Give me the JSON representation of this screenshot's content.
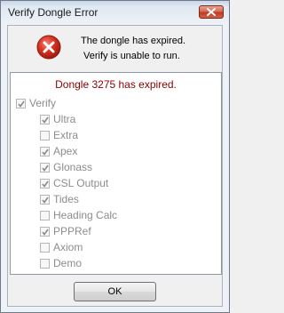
{
  "window": {
    "title": "Verify Dongle Error",
    "close_label": "Close"
  },
  "message": {
    "line1": "The dongle has expired.",
    "line2": "Verify is unable to run.",
    "icon": "error-icon"
  },
  "panel": {
    "status": "Dongle 3275 has expired.",
    "parent": {
      "label": "Verify",
      "checked": true
    },
    "items": [
      {
        "label": "Ultra",
        "checked": true
      },
      {
        "label": "Extra",
        "checked": false
      },
      {
        "label": "Apex",
        "checked": true
      },
      {
        "label": "Glonass",
        "checked": true
      },
      {
        "label": "CSL Output",
        "checked": true
      },
      {
        "label": "Tides",
        "checked": true
      },
      {
        "label": "Heading Calc",
        "checked": false
      },
      {
        "label": "PPPRef",
        "checked": true
      },
      {
        "label": "Axiom",
        "checked": false
      },
      {
        "label": "Demo",
        "checked": false
      }
    ]
  },
  "buttons": {
    "ok": "OK"
  },
  "colors": {
    "status_text": "#8b0000",
    "disabled_text": "#8c8c8c",
    "error_red": "#c8261c"
  }
}
